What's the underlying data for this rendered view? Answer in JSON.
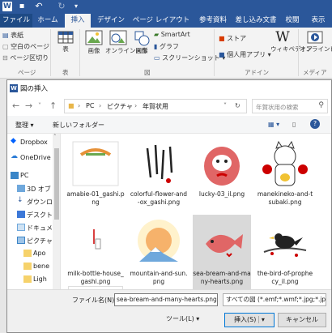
{
  "word": {
    "title_icons": [
      "word-app-icon",
      "save-icon",
      "undo-icon",
      "redo-icon",
      "customize-icon"
    ],
    "tabs": [
      "ファイル",
      "ホーム",
      "挿入",
      "デザイン",
      "ページ レイアウト",
      "参考資料",
      "差し込み文書",
      "校閲",
      "表示"
    ],
    "active_tab": "挿入",
    "ribbon": {
      "pages": [
        "表紙",
        "空白のページ",
        "ページ区切り"
      ],
      "pages_group": "ページ",
      "table_label": "表",
      "table_group": "表",
      "picture_label": "画像",
      "online_picture_label": "オンライン画像",
      "shapes_label": "図形",
      "smartart_label": "SmartArt",
      "graph_label": "グラフ",
      "screenshot_label": "スクリーンショット",
      "illustrations_group": "図",
      "store_label": "ストア",
      "my_apps_label": "個人用アプリ",
      "addins_group": "アドイン",
      "wikipedia_label": "ウィキペディア",
      "online_video_label": "オンラインビデオ",
      "media_group": "メディア"
    }
  },
  "dialog": {
    "title": "図の挿入",
    "breadcrumb": [
      "PC",
      "ピクチャ",
      "年賀状用"
    ],
    "search_placeholder": "年賀状用の検索",
    "organize": "整理",
    "new_folder": "新しいフォルダー",
    "nav_items": [
      "Dropbox",
      "OneDrive",
      "PC",
      "3D オブ",
      "ダウンロード",
      "デスクトップ",
      "ドキュメント",
      "ピクチャ",
      "Apo",
      "bene",
      "Ligh"
    ],
    "files": [
      {
        "name": "amabie-01_gashi.png"
      },
      {
        "name": "colorful-flower-and-ox_gashi.png"
      },
      {
        "name": "lucky-03_il.png"
      },
      {
        "name": "manekineko-and-tsubaki.png"
      },
      {
        "name": "milk-bottle-house_gashi.png"
      },
      {
        "name": "mountain-and-sun.png"
      },
      {
        "name": "sea-bream-and-many-hearts.png"
      },
      {
        "name": "the-bird-of-prophecy_il.png"
      }
    ],
    "selected_file": "sea-bream-and-many-hearts.png",
    "filename_label": "ファイル名(N):",
    "filename_value": "sea-bream-and-many-hearts.png",
    "filetype_value": "すべての図 (*.emf;*.wmf;*.jpg;*.jp",
    "tools_label": "ツール(L)",
    "insert_label": "挿入(S)",
    "cancel_label": "キャンセル"
  },
  "colors": {
    "word_blue": "#2b579a",
    "accent": "#0078d7"
  }
}
